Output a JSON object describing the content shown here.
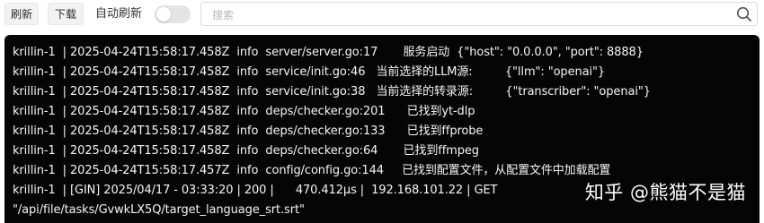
{
  "toolbar": {
    "refresh_label": "刷新",
    "download_label": "下载",
    "auto_refresh_label": "自动刷新",
    "auto_refresh_on": false
  },
  "search": {
    "placeholder": "搜索",
    "value": ""
  },
  "logs": [
    "krillin-1  | 2025-04-24T15:58:17.458Z  info  server/server.go:17       服务启动  {\"host\": \"0.0.0.0\", \"port\": 8888}",
    "krillin-1  | 2025-04-24T15:58:17.458Z  info  service/init.go:46   当前选择的LLM源:         {\"llm\": \"openai\"}",
    "krillin-1  | 2025-04-24T15:58:17.458Z  info  service/init.go:38   当前选择的转录源:         {\"transcriber\": \"openai\"}",
    "krillin-1  | 2025-04-24T15:58:17.458Z  info  deps/checker.go:201      已找到yt-dlp",
    "krillin-1  | 2025-04-24T15:58:17.458Z  info  deps/checker.go:133      已找到ffprobe",
    "krillin-1  | 2025-04-24T15:58:17.458Z  info  deps/checker.go:64       已找到ffmpeg",
    "krillin-1  | 2025-04-24T15:58:17.457Z  info  config/config.go:144     已找到配置文件，从配置文件中加载配置",
    "krillin-1  | [GIN] 2025/04/17 - 03:33:20 | 200 |      470.412µs |  192.168.101.22 | GET",
    "\"/api/file/tasks/GvwkLX5Q/target_language_srt.srt\""
  ],
  "watermark": "知乎 @熊猫不是猫",
  "colors": {
    "console_bg": "#050505",
    "console_text": "#f5f5f5",
    "button_bg": "#f2f2f3",
    "toggle_off": "#e4e4e7"
  }
}
